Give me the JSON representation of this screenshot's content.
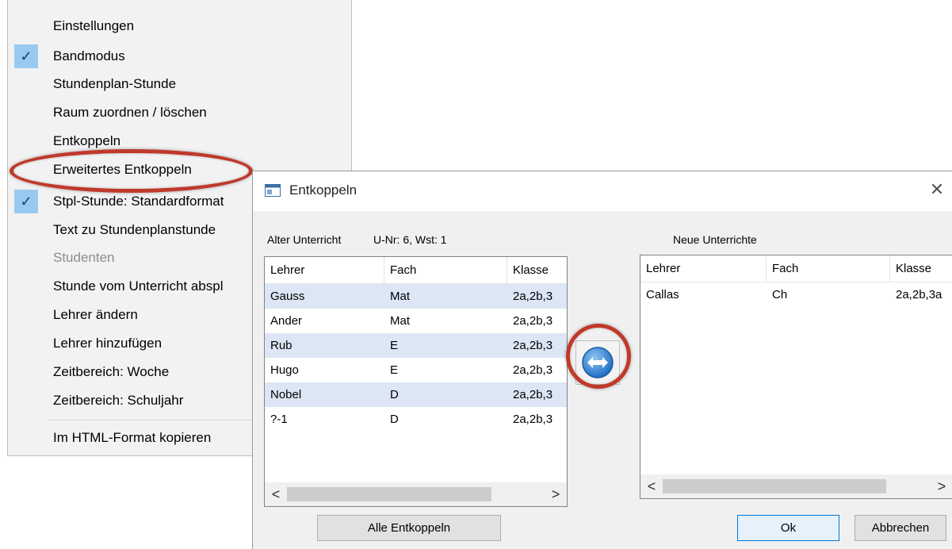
{
  "context_menu": {
    "items": [
      {
        "label": "Einstellungen",
        "checked": false,
        "disabled": false
      },
      {
        "label": "Bandmodus",
        "checked": true,
        "disabled": false
      },
      {
        "label": "Stundenplan-Stunde",
        "checked": false,
        "disabled": false
      },
      {
        "label": "Raum zuordnen / löschen",
        "checked": false,
        "disabled": false
      },
      {
        "label": "Entkoppeln",
        "checked": false,
        "disabled": false
      },
      {
        "label": "Erweitertes Entkoppeln",
        "checked": false,
        "disabled": false
      },
      {
        "label": "Stpl-Stunde: Standardformat",
        "checked": true,
        "disabled": false
      },
      {
        "label": "Text zu Stundenplanstunde",
        "checked": false,
        "disabled": false
      },
      {
        "label": "Studenten",
        "checked": false,
        "disabled": true
      },
      {
        "label": "Stunde vom Unterricht abspl",
        "checked": false,
        "disabled": false
      },
      {
        "label": "Lehrer ändern",
        "checked": false,
        "disabled": false
      },
      {
        "label": "Lehrer hinzufügen",
        "checked": false,
        "disabled": false
      },
      {
        "label": "Zeitbereich: Woche",
        "checked": false,
        "disabled": false
      },
      {
        "label": "Zeitbereich: Schuljahr",
        "checked": false,
        "disabled": false
      },
      {
        "label": "Im HTML-Format kopieren",
        "checked": false,
        "disabled": false
      }
    ],
    "check_glyph": "✓"
  },
  "dialog": {
    "title": "Entkoppeln",
    "close_glyph": "✕",
    "old_label": "Alter Unterricht",
    "old_info": "U-Nr: 6, Wst: 1",
    "new_label": "Neue Unterrichte",
    "old_table": {
      "headers": [
        "Lehrer",
        "Fach",
        "Klasse"
      ],
      "rows": [
        [
          "Gauss",
          "Mat",
          "2a,2b,3"
        ],
        [
          "Ander",
          "Mat",
          "2a,2b,3"
        ],
        [
          "Rub",
          "E",
          "2a,2b,3"
        ],
        [
          "Hugo",
          "E",
          "2a,2b,3"
        ],
        [
          "Nobel",
          "D",
          "2a,2b,3"
        ],
        [
          "?-1",
          "D",
          "2a,2b,3"
        ]
      ]
    },
    "new_table": {
      "headers": [
        "Lehrer",
        "Fach",
        "Klasse"
      ],
      "rows": [
        [
          "Callas",
          "Ch",
          "2a,2b,3a"
        ]
      ]
    },
    "scroll_left": "<",
    "scroll_right": ">",
    "buttons": {
      "unlink_all": "Alle Entkoppeln",
      "ok": "Ok",
      "cancel": "Abbrechen"
    }
  },
  "colors": {
    "highlight_ring": "#c0392b",
    "check_bg": "#99c9ef",
    "row_alt": "#dce6f4",
    "transfer_icon": "#2b7fd4"
  }
}
